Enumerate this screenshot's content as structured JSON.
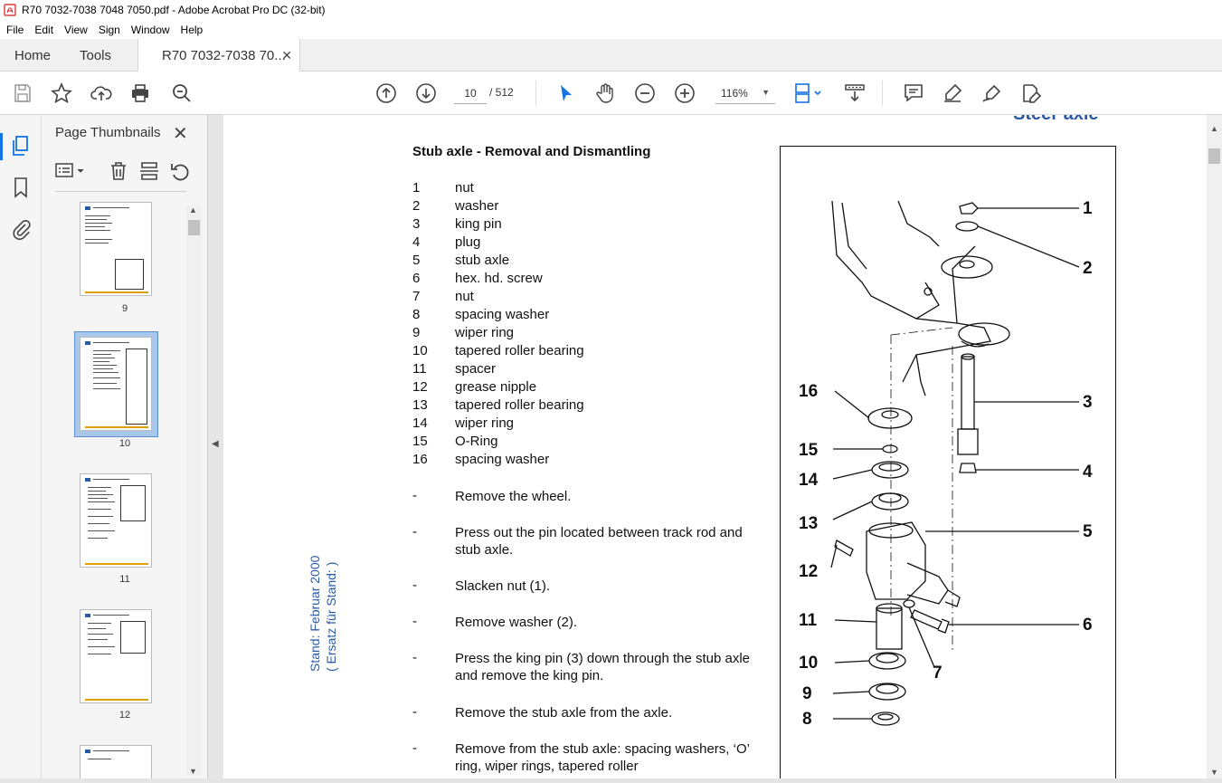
{
  "window": {
    "title": "R70 7032-7038 7048 7050.pdf - Adobe Acrobat Pro DC (32-bit)"
  },
  "menu": [
    "File",
    "Edit",
    "View",
    "Sign",
    "Window",
    "Help"
  ],
  "tabs": {
    "home": "Home",
    "tools": "Tools",
    "document": "R70 7032-7038 70..."
  },
  "toolbar": {
    "current_page": "10",
    "total_pages": "/ 512",
    "zoom": "116%"
  },
  "panel": {
    "title": "Page Thumbnails",
    "thumbnails": [
      {
        "label": "9",
        "selected": false
      },
      {
        "label": "10",
        "selected": true
      },
      {
        "label": "11",
        "selected": false
      },
      {
        "label": "12",
        "selected": false
      }
    ]
  },
  "document": {
    "section_header": "Steer axle",
    "heading": "Stub axle - Removal and Dismantling",
    "parts": [
      {
        "num": "1",
        "name": "nut"
      },
      {
        "num": "2",
        "name": "washer"
      },
      {
        "num": "3",
        "name": "king pin"
      },
      {
        "num": "4",
        "name": "plug"
      },
      {
        "num": "5",
        "name": "stub axle"
      },
      {
        "num": "6",
        "name": "hex. hd. screw"
      },
      {
        "num": "7",
        "name": "nut"
      },
      {
        "num": "8",
        "name": "spacing washer"
      },
      {
        "num": "9",
        "name": "wiper ring"
      },
      {
        "num": "10",
        "name": "tapered roller bearing"
      },
      {
        "num": "11",
        "name": "spacer"
      },
      {
        "num": "12",
        "name": "grease nipple"
      },
      {
        "num": "13",
        "name": "tapered roller bearing"
      },
      {
        "num": "14",
        "name": "wiper ring"
      },
      {
        "num": "15",
        "name": "O-Ring"
      },
      {
        "num": "16",
        "name": "spacing washer"
      }
    ],
    "steps": [
      {
        "dash": "-",
        "text": "Remove the wheel."
      },
      {
        "dash": "-",
        "text": "Press out the pin located between track rod and stub axle."
      },
      {
        "dash": "-",
        "text": "Slacken nut (1)."
      },
      {
        "dash": "-",
        "text": "Remove washer (2)."
      },
      {
        "dash": "-",
        "text": "Press the king pin (3) down through the stub axle and remove the king pin."
      },
      {
        "dash": "-",
        "text": "Remove the stub axle from the axle."
      },
      {
        "dash": "-",
        "text": "Remove from the stub axle: spacing washers, ‘O’ ring, wiper rings, tapered roller"
      }
    ],
    "stamp_line1": "Stand: Februar 2000",
    "stamp_line2": "( Ersatz für Stand:      )",
    "figure_callouts": [
      "1",
      "2",
      "3",
      "4",
      "5",
      "6",
      "7",
      "8",
      "9",
      "10",
      "11",
      "12",
      "13",
      "14",
      "15",
      "16"
    ]
  },
  "icons": {
    "title": "acrobat-pdf-icon",
    "toolbar": [
      "save-icon",
      "bookmark-star-icon",
      "upload-icon",
      "print-icon",
      "search-zoom-icon",
      "prev-page-icon",
      "next-page-icon",
      "select-arrow-icon",
      "hand-icon",
      "zoom-out-icon",
      "zoom-in-icon",
      "page-fit-icon",
      "scroll-mode-icon",
      "comment-icon",
      "highlight-icon",
      "sign-icon",
      "edit-pdf-icon"
    ]
  },
  "colors": {
    "accent": "#1473e6",
    "doc_blue": "#2b5aa8",
    "selection": "#a9c7ea"
  }
}
